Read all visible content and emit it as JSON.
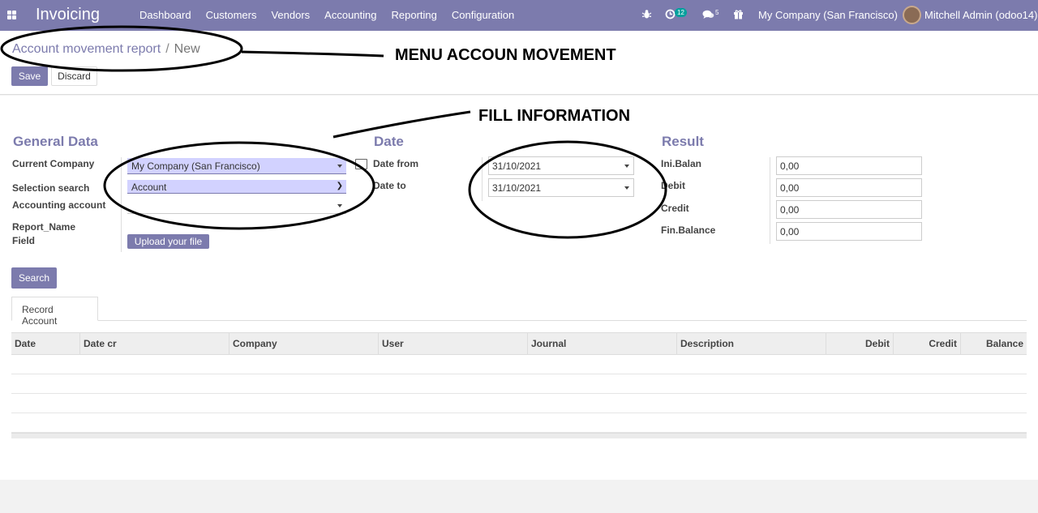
{
  "navbar": {
    "app_name": "Invoicing",
    "menu": [
      "Dashboard",
      "Customers",
      "Vendors",
      "Accounting",
      "Reporting",
      "Configuration"
    ],
    "activity_count": "12",
    "message_count": "5",
    "company": "My Company (San Francisco)",
    "user": "Mitchell Admin (odoo14)"
  },
  "control_panel": {
    "breadcrumb_parent": "Account movement report",
    "breadcrumb_sep": "/",
    "breadcrumb_current": "New",
    "save_label": "Save",
    "discard_label": "Discard"
  },
  "form": {
    "general": {
      "title": "General Data",
      "current_company_label": "Current Company",
      "current_company_value": "My Company (San Francisco)",
      "selection_search_label": "Selection search",
      "selection_search_value": "Account",
      "accounting_account_label": "Accounting account",
      "accounting_account_value": "",
      "report_name_label": "Report_Name",
      "field_label": "Field",
      "upload_label": "Upload your file"
    },
    "date": {
      "title": "Date",
      "date_from_label": "Date from",
      "date_from_value": "31/10/2021",
      "date_to_label": "Date to",
      "date_to_value": "31/10/2021"
    },
    "result": {
      "title": "Result",
      "ini_balance_label": "Ini.Balan",
      "ini_balance_value": "0,00",
      "debit_label": "Debit",
      "debit_value": "0,00",
      "credit_label": "Credit",
      "credit_value": "0,00",
      "fin_balance_label": "Fin.Balance",
      "fin_balance_value": "0,00"
    },
    "search_label": "Search",
    "tab_label": "Record Account"
  },
  "table": {
    "columns": [
      "Date",
      "Date cr",
      "Company",
      "User",
      "Journal",
      "Description",
      "Debit",
      "Credit",
      "Balance"
    ]
  },
  "annotations": {
    "menu_note": "MENU ACCOUN MOVEMENT",
    "fill_note": "FILL INFORMATION"
  }
}
